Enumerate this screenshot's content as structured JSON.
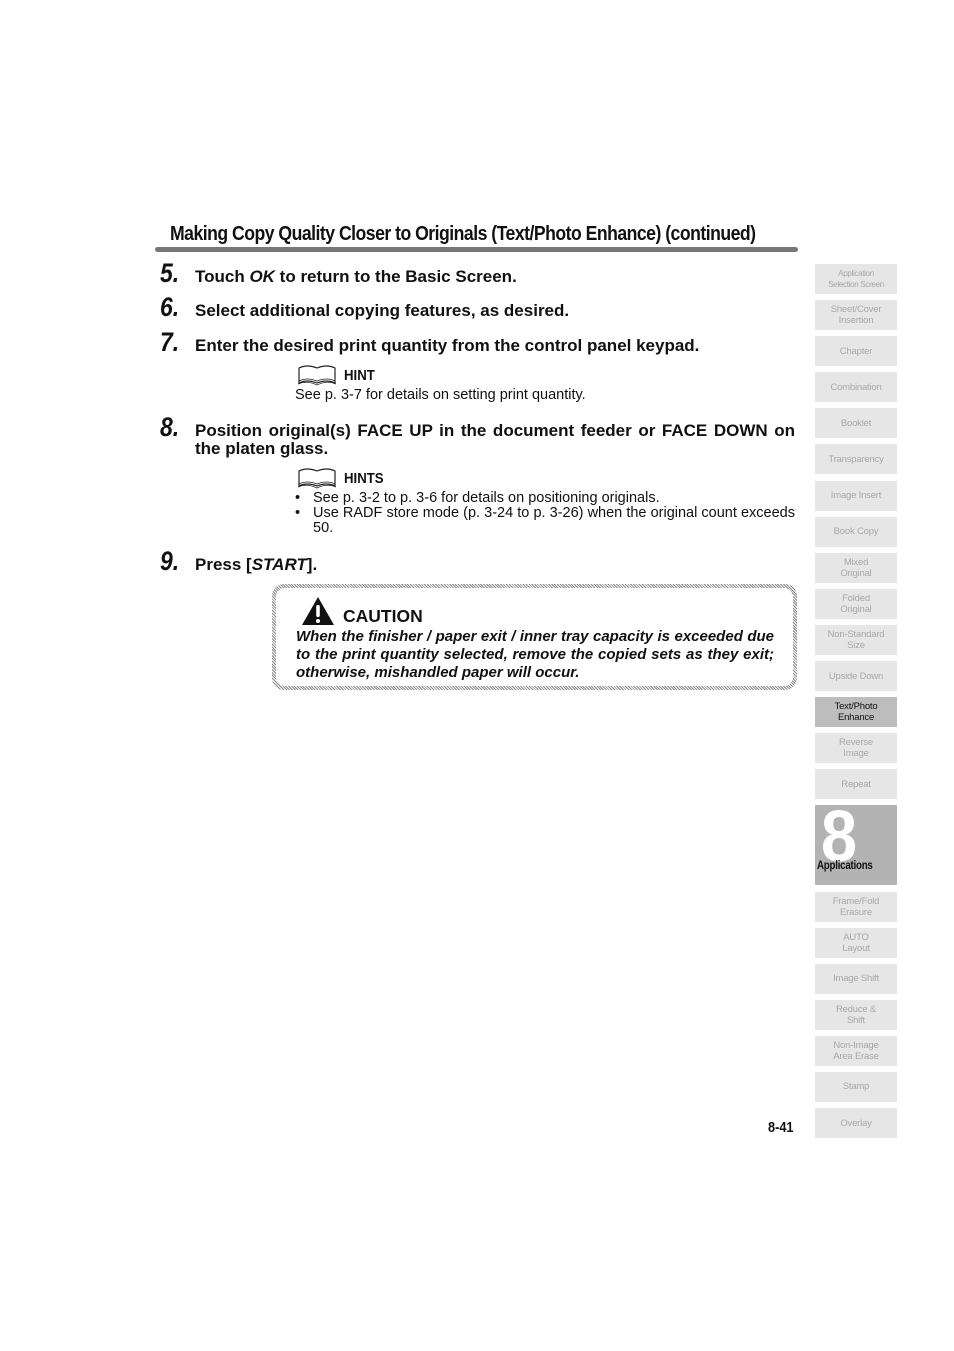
{
  "heading": "Making Copy Quality Closer to Originals (Text/Photo Enhance) (continued)",
  "steps": [
    {
      "num": "5.",
      "before": "Touch ",
      "em": "OK",
      "after": " to return to the Basic Screen."
    },
    {
      "num": "6.",
      "text": "Select additional copying features, as desired."
    },
    {
      "num": "7.",
      "text": "Enter the desired print quantity from the control panel keypad."
    },
    {
      "num": "8.",
      "text": "Position original(s) FACE UP in the document feeder or FACE DOWN on the platen glass."
    },
    {
      "num": "9.",
      "before": "Press [",
      "em": "START",
      "after": "]."
    }
  ],
  "hint1": {
    "icon": "book-icon",
    "label": "HINT",
    "text": "See p. 3-7 for details on setting print quantity."
  },
  "hint2": {
    "icon": "book-icon",
    "label": "HINTS",
    "bullet": "•",
    "items": [
      "See p. 3-2 to p. 3-6 for details on positioning originals.",
      "Use RADF store mode (p. 3-24 to p. 3-26) when the original count exceeds 50."
    ]
  },
  "caution": {
    "icon": "warning-triangle-icon",
    "label": "CAUTION",
    "text": "When the finisher / paper exit / inner tray capacity is exceeded due to the print quantity selected, remove the copied sets as they exit; otherwise, mishandled paper will occur."
  },
  "page_number": "8-41",
  "side_tabs": [
    {
      "label": "Application\nSelection Screen",
      "small": true
    },
    {
      "label": "Sheet/Cover\nInsertion"
    },
    {
      "label": "Chapter"
    },
    {
      "label": "Combination"
    },
    {
      "label": "Booklet"
    },
    {
      "label": "Transparency"
    },
    {
      "label": "Image Insert"
    },
    {
      "label": "Book Copy"
    },
    {
      "label": "Mixed\nOriginal"
    },
    {
      "label": "Folded\nOriginal"
    },
    {
      "label": "Non-Standard\nSize"
    },
    {
      "label": "Upside Down"
    },
    {
      "label": "Text/Photo\nEnhance",
      "active": true
    },
    {
      "label": "Reverse\nImage"
    },
    {
      "label": "Repeat"
    },
    {
      "chapter": true,
      "number": "8",
      "label": "Applications"
    },
    {
      "label": "Frame/Fold\nErasure"
    },
    {
      "label": "AUTO\nLayout"
    },
    {
      "label": "Image Shift"
    },
    {
      "label": "Reduce &\nShift"
    },
    {
      "label": "Non-Image\nArea Erase"
    },
    {
      "label": "Stamp"
    },
    {
      "label": "Overlay"
    }
  ]
}
